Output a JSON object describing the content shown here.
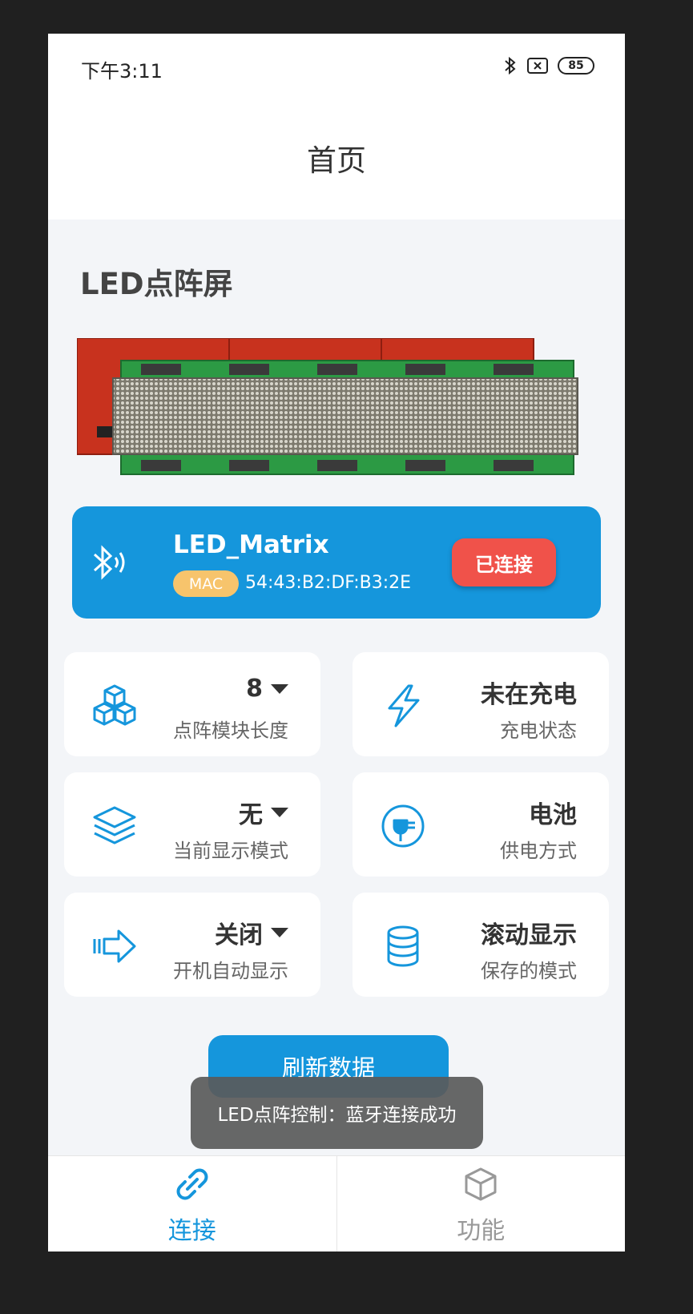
{
  "status_bar": {
    "time": "下午3:11",
    "battery": "85",
    "icons": [
      "bluetooth-icon",
      "no-sim-icon",
      "battery-icon"
    ]
  },
  "nav": {
    "title": "首页"
  },
  "section": {
    "title": "LED点阵屏"
  },
  "device": {
    "name": "LED_Matrix",
    "mac_label": "MAC",
    "mac": "54:43:B2:DF:B3:2E",
    "status_button": "已连接"
  },
  "cards": [
    {
      "value": "8",
      "label": "点阵模块长度",
      "dropdown": true,
      "icon": "cubes-icon"
    },
    {
      "value": "未在充电",
      "label": "充电状态",
      "dropdown": false,
      "icon": "lightning-icon"
    },
    {
      "value": "无",
      "label": "当前显示模式",
      "dropdown": true,
      "icon": "layers-icon"
    },
    {
      "value": "电池",
      "label": "供电方式",
      "dropdown": false,
      "icon": "plug-icon"
    },
    {
      "value": "关闭",
      "label": "开机自动显示",
      "dropdown": true,
      "icon": "arrow-right-icon"
    },
    {
      "value": "滚动显示",
      "label": "保存的模式",
      "dropdown": false,
      "icon": "database-icon"
    }
  ],
  "refresh_button": "刷新数据",
  "toast": "LED点阵控制：蓝牙连接成功",
  "tabs": [
    {
      "label": "连接",
      "icon": "link-icon",
      "active": true
    },
    {
      "label": "功能",
      "icon": "cube-icon",
      "active": false
    }
  ],
  "colors": {
    "accent": "#1596dc",
    "connected": "#f0524a",
    "mac_badge": "#f7c46c",
    "background": "#f3f5f8"
  }
}
